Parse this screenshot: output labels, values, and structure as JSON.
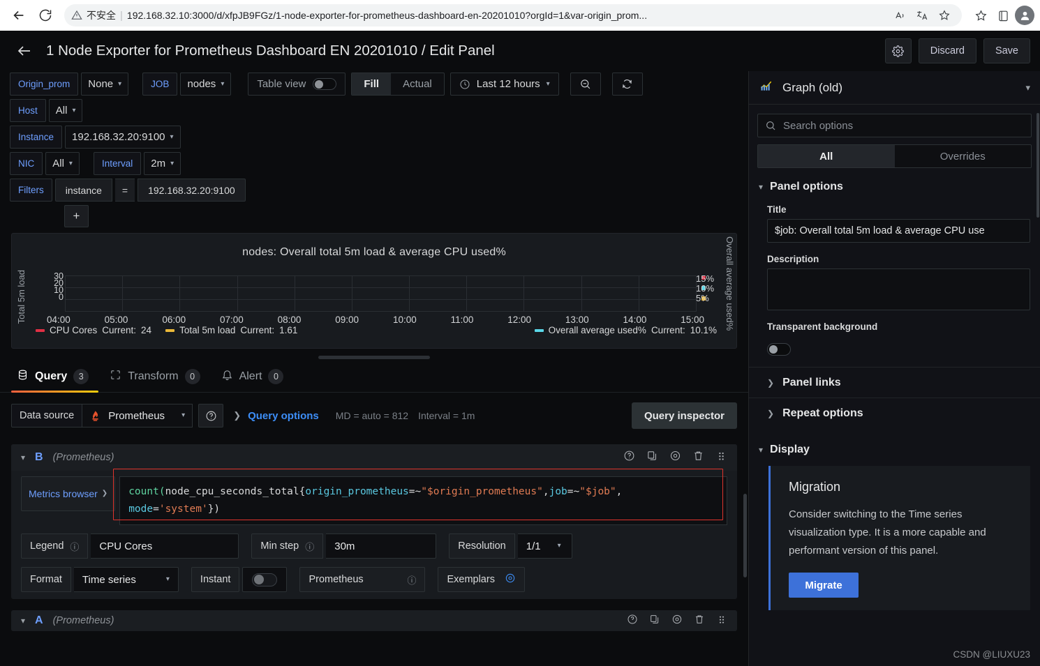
{
  "browser": {
    "back_icon": "back-arrow-icon",
    "reload_icon": "reload-icon",
    "security_icon": "warning-triangle-icon",
    "security_label": "不安全",
    "url": "192.168.32.10:3000/d/xfpJB9FGz/1-node-exporter-for-prometheus-dashboard-en-20201010?orgId=1&var-origin_prom...",
    "read_aloud_icon": "read-aloud-icon",
    "translate_icon": "translate-icon",
    "add_favorite_icon": "add-favorite-icon",
    "favorites_icon": "favorites-icon",
    "collections_icon": "collections-icon",
    "profile_icon": "profile-avatar-icon"
  },
  "header": {
    "back_icon": "back-arrow-icon",
    "title": "1 Node Exporter for Prometheus Dashboard EN 20201010 / Edit Panel",
    "settings_icon": "gear-icon",
    "discard_label": "Discard",
    "save_label": "Save"
  },
  "variables": [
    {
      "label": "Origin_prom",
      "value": "None",
      "has_caret": true
    },
    {
      "label": "JOB",
      "value": "nodes",
      "has_caret": true
    },
    {
      "label": "Host",
      "value": "All",
      "has_caret": true
    },
    {
      "label": "Instance",
      "value": "192.168.32.20:9100",
      "has_caret": true
    },
    {
      "label": "NIC",
      "value": "All",
      "has_caret": true
    },
    {
      "label": "Interval",
      "value": "2m",
      "has_caret": true
    },
    {
      "label": "Filters",
      "value": "",
      "has_caret": false
    }
  ],
  "filters": {
    "label": "Filters",
    "key": "instance",
    "operator": "=",
    "value": "192.168.32.20:9100",
    "add_label": "+"
  },
  "toolbar": {
    "table_view_label": "Table view",
    "table_view_on": false,
    "fill_label": "Fill",
    "actual_label": "Actual",
    "fill_active": true,
    "clock_icon": "clock-icon",
    "time_range": "Last 12 hours",
    "zoom_out_icon": "zoom-out-icon",
    "refresh_icon": "refresh-icon"
  },
  "chart_data": {
    "type": "line",
    "title": "nodes:  Overall total 5m load & average CPU used%",
    "xlabel": "",
    "ylabel": "Total 5m load",
    "y2label": "Overall average used%",
    "x_ticks": [
      "04:00",
      "05:00",
      "06:00",
      "07:00",
      "08:00",
      "09:00",
      "10:00",
      "11:00",
      "12:00",
      "13:00",
      "14:00",
      "15:00"
    ],
    "y_ticks_left": [
      "30",
      "20",
      "10",
      "0"
    ],
    "y_ticks_right": [
      "15%",
      "10%",
      "5%"
    ],
    "ylim": [
      0,
      30
    ],
    "y2lim": [
      0,
      17.5
    ],
    "grid": true,
    "legend_position": "bottom",
    "series": [
      {
        "name": "CPU Cores",
        "current_label": "Current:",
        "current": "24",
        "color": "#e02f44",
        "values": [
          24
        ]
      },
      {
        "name": "Total 5m load",
        "current_label": "Current:",
        "current": "1.61",
        "color": "#eab839",
        "values": [
          1.61
        ]
      },
      {
        "name": "Overall average used%",
        "current_label": "Current:",
        "current": "10.1%",
        "color": "#5ad7e8",
        "values": [
          10.1
        ]
      }
    ]
  },
  "tabs": [
    {
      "label": "Query",
      "badge": "3",
      "icon": "database-icon",
      "active": true
    },
    {
      "label": "Transform",
      "badge": "0",
      "icon": "transform-icon",
      "active": false
    },
    {
      "label": "Alert",
      "badge": "0",
      "icon": "bell-icon",
      "active": false
    }
  ],
  "query_toolbar": {
    "data_source_label": "Data source",
    "data_source_value": "Prometheus",
    "data_source_icon": "prometheus-logo-icon",
    "help_icon": "help-circle-icon",
    "query_options_label": "Query options",
    "query_options_meta_md": "MD = auto = 812",
    "query_options_meta_interval": "Interval = 1m",
    "query_inspector_label": "Query inspector"
  },
  "query_b": {
    "letter": "B",
    "datasource": "(Prometheus)",
    "icons": [
      "help-circle-icon",
      "duplicate-icon",
      "eye-icon",
      "trash-icon",
      "drag-handle-icon"
    ],
    "metrics_browser_label": "Metrics browser",
    "expr_tokens": [
      {
        "t": "count(",
        "c": "func"
      },
      {
        "t": "node_cpu_seconds_total{",
        "c": "metric"
      },
      {
        "t": "origin_prometheus",
        "c": "label"
      },
      {
        "t": "=~",
        "c": "punct"
      },
      {
        "t": "\"$origin_prometheus\"",
        "c": "str"
      },
      {
        "t": ",",
        "c": "punct"
      },
      {
        "t": "job",
        "c": "label"
      },
      {
        "t": "=~",
        "c": "punct"
      },
      {
        "t": "\"$job\"",
        "c": "str"
      },
      {
        "t": ",",
        "c": "punct"
      }
    ],
    "expr_line2": [
      {
        "t": "mode",
        "c": "label"
      },
      {
        "t": "=",
        "c": "punct"
      },
      {
        "t": "'system'",
        "c": "str"
      },
      {
        "t": "})",
        "c": "punct"
      }
    ],
    "legend_label": "Legend",
    "legend_value": "CPU Cores",
    "min_step_label": "Min step",
    "min_step_value": "30m",
    "resolution_label": "Resolution",
    "resolution_value": "1/1",
    "format_label": "Format",
    "format_value": "Time series",
    "instant_label": "Instant",
    "instant_on": false,
    "prometheus_label": "Prometheus",
    "exemplars_label": "Exemplars"
  },
  "query_a": {
    "letter": "A",
    "datasource": "(Prometheus)"
  },
  "options_pane": {
    "viz_icon": "graph-icon",
    "viz_name": "Graph (old)",
    "search_icon": "search-icon",
    "search_placeholder": "Search options",
    "tab_all": "All",
    "tab_overrides": "Overrides",
    "panel_options_label": "Panel options",
    "title_label": "Title",
    "title_value": "$job:  Overall total 5m load & average CPU use",
    "description_label": "Description",
    "description_value": "",
    "transparent_label": "Transparent background",
    "transparent_on": false,
    "panel_links_label": "Panel links",
    "repeat_options_label": "Repeat options",
    "display_label": "Display",
    "migration_title": "Migration",
    "migration_text": "Consider switching to the Time series visualization type. It is a more capable and performant version of this panel.",
    "migrate_button": "Migrate"
  },
  "watermark": "CSDN @LIUXU23",
  "colors": {
    "accent_blue": "#6e9fff",
    "link_blue": "#3d8ef7",
    "migrate_blue": "#3d71d9",
    "red_outline": "#e0342c",
    "orange_tab": "#f55f3e"
  }
}
